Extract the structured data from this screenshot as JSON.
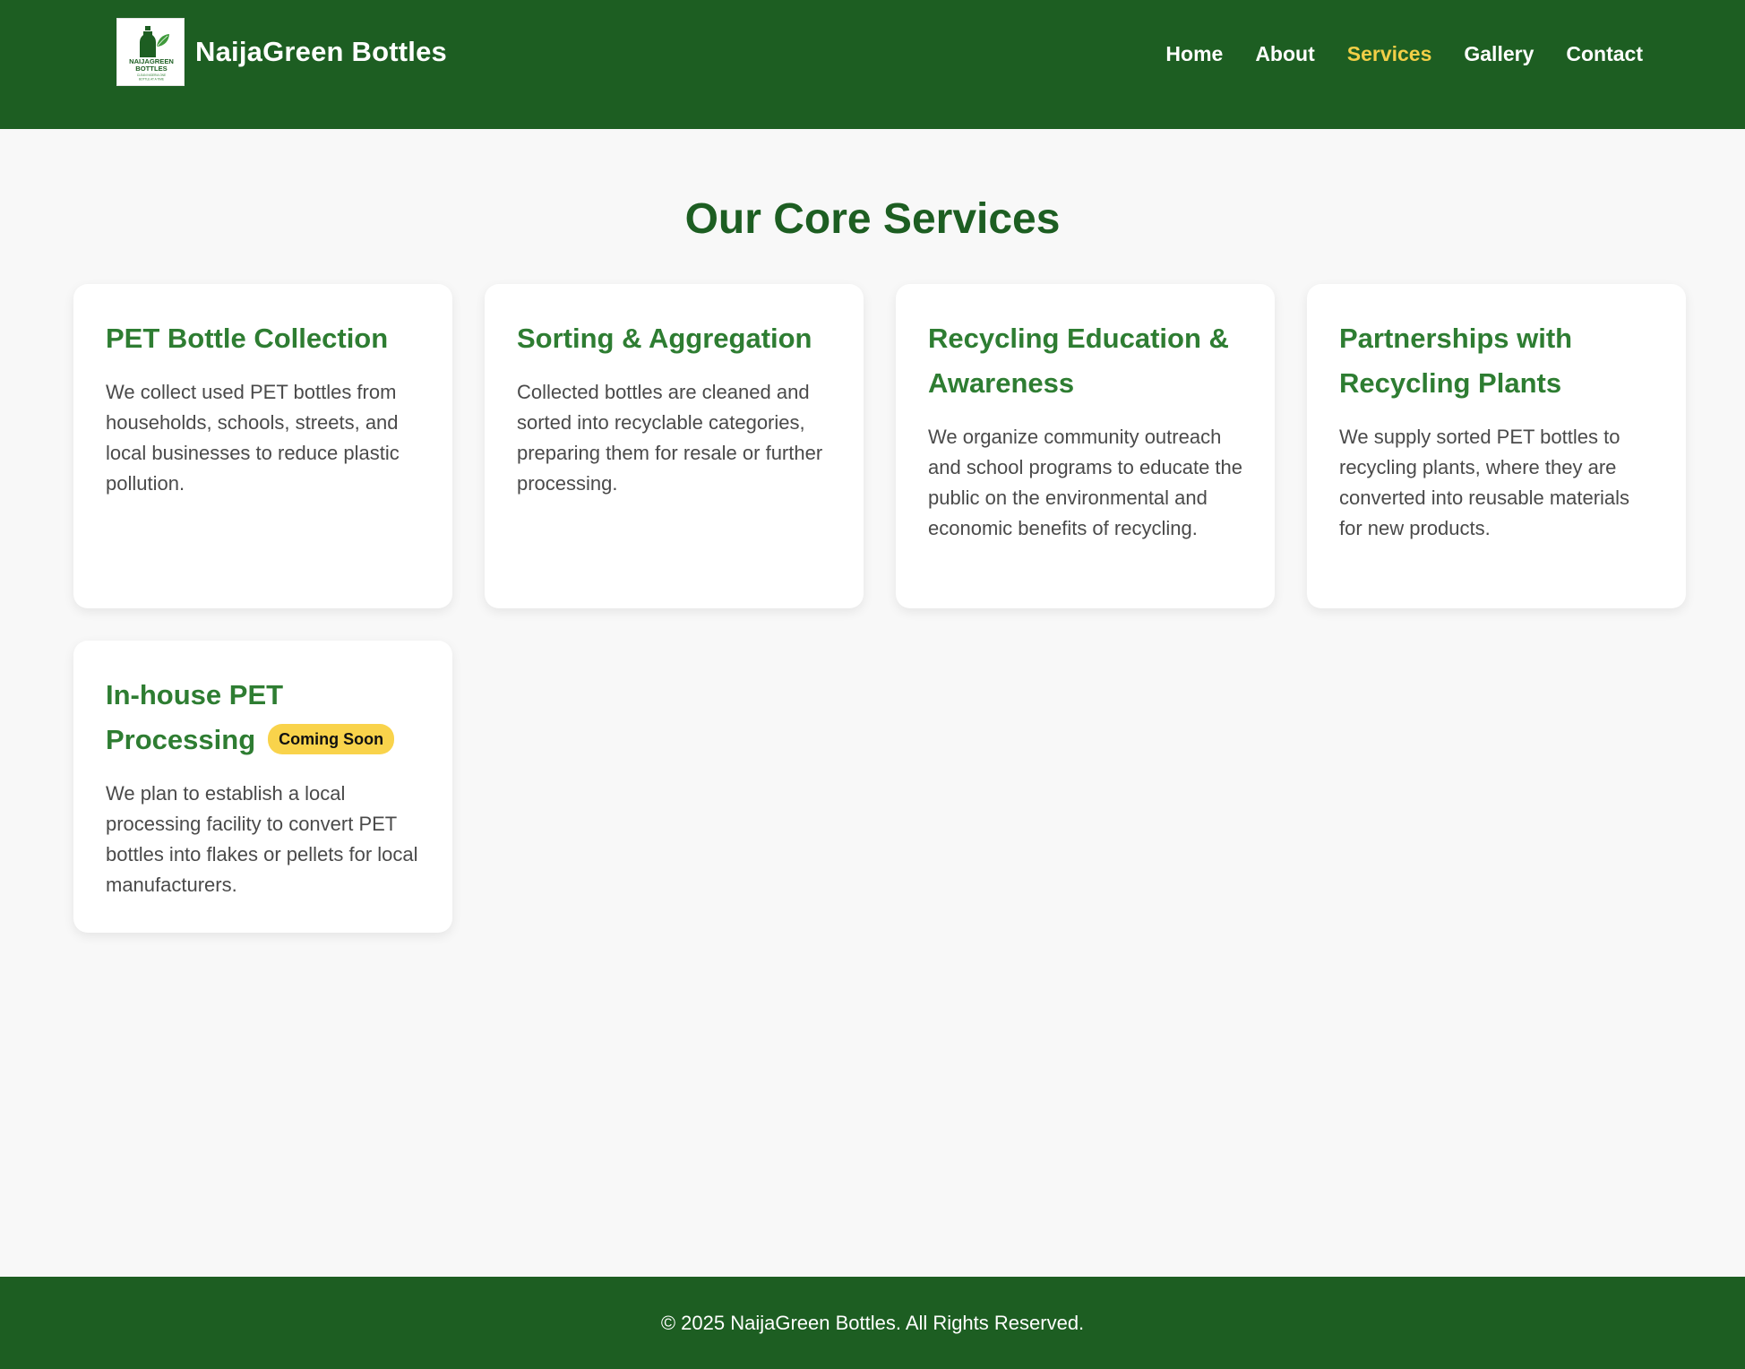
{
  "header": {
    "brand_name": "NaijaGreen Bottles",
    "logo": {
      "icon": "bottle-leaf-logo",
      "line1": "NAIJAGREEN",
      "line2": "BOTTLES",
      "tagline1": "CLEAN NIGERIA ONE",
      "tagline2": "BOTTLE AT A TIME"
    },
    "nav": [
      {
        "label": "Home",
        "active": false
      },
      {
        "label": "About",
        "active": false
      },
      {
        "label": "Services",
        "active": true
      },
      {
        "label": "Gallery",
        "active": false
      },
      {
        "label": "Contact",
        "active": false
      }
    ]
  },
  "main": {
    "title": "Our Core Services",
    "cards": [
      {
        "title": "PET Bottle Collection",
        "description": "We collect used PET bottles from households, schools, streets, and local businesses to reduce plastic pollution."
      },
      {
        "title": "Sorting & Aggregation",
        "description": "Collected bottles are cleaned and sorted into recyclable categories, preparing them for resale or further processing."
      },
      {
        "title": "Recycling Education & Awareness",
        "description": "We organize community outreach and school programs to educate the public on the environmental and economic benefits of recycling."
      },
      {
        "title": "Partnerships with Recycling Plants",
        "description": "We supply sorted PET bottles to recycling plants, where they are converted into reusable materials for new products."
      },
      {
        "title": "In-house PET Processing",
        "badge": "Coming Soon",
        "description": "We plan to establish a local processing facility to convert PET bottles into flakes or pellets for local manufacturers."
      }
    ]
  },
  "footer": {
    "text": "© 2025 NaijaGreen Bottles. All Rights Reserved."
  },
  "colors": {
    "primary": "#1d5e22",
    "card_title": "#2e7d32",
    "nav_active": "#f2cf47",
    "badge": "#f9d34b",
    "background": "#f8f8f8"
  }
}
